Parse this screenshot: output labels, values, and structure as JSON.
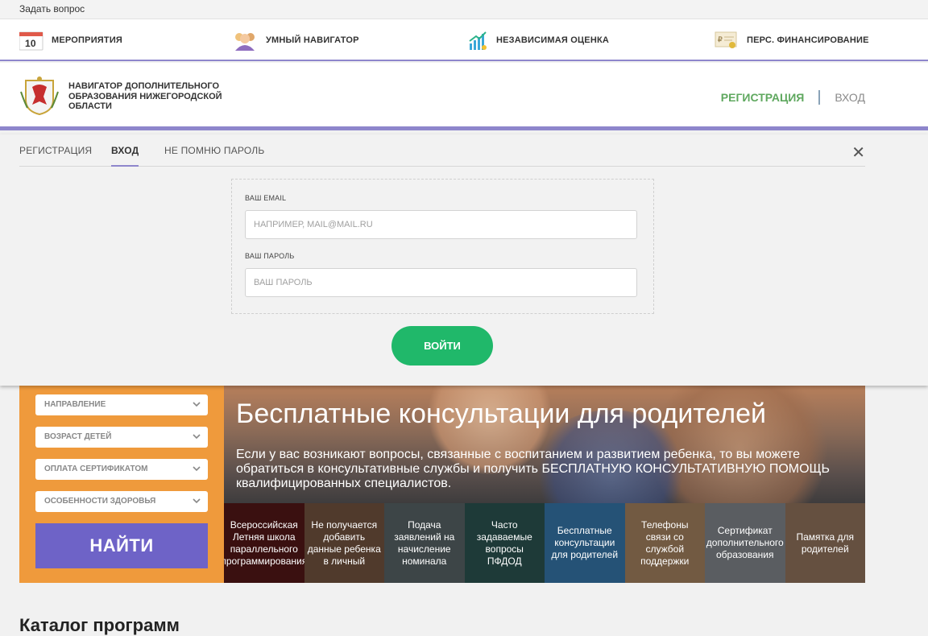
{
  "topbar": {
    "ask_label": "Задать вопрос"
  },
  "category_nav": {
    "items": [
      {
        "label": "МЕРОПРИЯТИЯ",
        "icon": "calendar-icon",
        "icon_text": "10"
      },
      {
        "label": "УМНЫЙ НАВИГАТОР",
        "icon": "people-icon"
      },
      {
        "label": "НЕЗАВИСИМАЯ ОЦЕНКА",
        "icon": "chart-growth-icon"
      },
      {
        "label": "ПЕРС. ФИНАНСИРОВАНИЕ",
        "icon": "certificate-icon"
      }
    ]
  },
  "header": {
    "org_name": "НАВИГАТОР ДОПОЛНИТЕЛЬНОГО ОБРАЗОВАНИЯ НИЖЕГОРОДСКОЙ ОБЛАСТИ",
    "register_label": "РЕГИСТРАЦИЯ",
    "login_label": "ВХОД"
  },
  "login_panel": {
    "tabs": [
      {
        "label": "РЕГИСТРАЦИЯ",
        "active": false
      },
      {
        "label": "ВХОД",
        "active": true
      },
      {
        "label": "НЕ ПОМНЮ ПАРОЛЬ",
        "active": false
      }
    ],
    "close_symbol": "✕",
    "email_label": "ВАШ EMAIL",
    "email_placeholder": "НАПРИМЕР, MAIL@MAIL.RU",
    "password_label": "ВАШ ПАРОЛЬ",
    "password_placeholder": "ВАШ ПАРОЛЬ",
    "submit_label": "ВОЙТИ"
  },
  "filter": {
    "selects": [
      "НАПРАВЛЕНИЕ",
      "ВОЗРАСТ ДЕТЕЙ",
      "ОПЛАТА СЕРТИФИКАТОМ",
      "ОСОБЕННОСТИ ЗДОРОВЬЯ"
    ],
    "find_label": "НАЙТИ"
  },
  "hero": {
    "title": "Бесплатные консультации для родителей",
    "subtitle": "Если у вас возникают вопросы, связанные с воспитанием и развитием ребенка, то вы можете обратиться в консультативные службы и получить БЕСПЛАТНУЮ КОНСУЛЬТАТИВНУЮ ПОМОЩЬ квалифицированных специалистов."
  },
  "tiles": [
    {
      "label": "Всероссийская Летняя школа параллельного программирования",
      "color": "#5a1a1a"
    },
    {
      "label": "Не получается добавить данные ребенка в личный",
      "color": "#7b5a44"
    },
    {
      "label": "Подача заявлений на начисление номинала",
      "color": "#5f6a6e"
    },
    {
      "label": "Часто задаваемые вопросы ПФДОД",
      "color": "#2f5a57"
    },
    {
      "label": "Бесплатные консультации для родителей",
      "color": "#3a7fb6"
    },
    {
      "label": "Телефоны связи со службой поддержки",
      "color": "#b08a66"
    },
    {
      "label": "Сертификат дополнительного образования",
      "color": "#8a8f95"
    },
    {
      "label": "Памятка для родителей",
      "color": "#9c7b63"
    }
  ],
  "catalog": {
    "title": "Каталог программ"
  },
  "colors": {
    "accent_purple": "#8e86cc",
    "register_green": "#5fa85f",
    "submit_green": "#20b86a",
    "filter_orange": "#ef9a3c",
    "find_button": "#6e63c7"
  }
}
